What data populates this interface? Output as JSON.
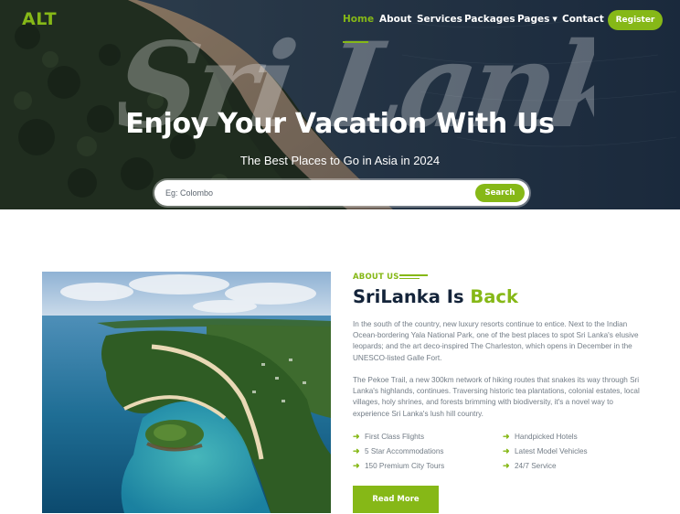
{
  "header": {
    "logo": "ALT",
    "nav": [
      {
        "label": "Home",
        "active": true
      },
      {
        "label": "About",
        "active": false
      },
      {
        "label": "Services",
        "active": false
      },
      {
        "label": "Packages",
        "active": false
      },
      {
        "label": "Pages",
        "active": false,
        "dropdown": true
      },
      {
        "label": "Contact",
        "active": false
      }
    ],
    "register_label": "Register"
  },
  "hero": {
    "script_text": "Sri Lanka",
    "title": "Enjoy Your Vacation With Us",
    "subtitle": "The Best Places to Go in Asia in 2024",
    "search": {
      "placeholder": "Eg: Colombo",
      "value": "",
      "button_label": "Search"
    }
  },
  "about": {
    "eyebrow": "ABOUT US",
    "title_main": "SriLanka Is ",
    "title_accent": "Back",
    "paragraphs": [
      "In the south of the country, new luxury resorts continue to entice. Next to the Indian Ocean-bordering Yala National Park, one of the best places to spot Sri Lanka's elusive leopards; and the art deco-inspired The Charleston, which opens in December in the UNESCO-listed Galle Fort.",
      "The Pekoe Trail, a new 300km network of hiking routes that snakes its way through Sri Lanka's highlands, continues. Traversing historic tea plantations, colonial estates, local villages, holy shrines, and forests brimming with biodiversity, it's a novel way to experience Sri Lanka's lush hill country."
    ],
    "features": [
      "First Class Flights",
      "Handpicked Hotels",
      "5 Star Accommodations",
      "Latest Model Vehicles",
      "150 Premium City Tours",
      "24/7 Service"
    ],
    "feature_icon": "arrow-right-icon",
    "read_more_label": "Read More"
  },
  "colors": {
    "accent": "#86b817",
    "heading": "#14243a",
    "body_text": "#727c86"
  }
}
